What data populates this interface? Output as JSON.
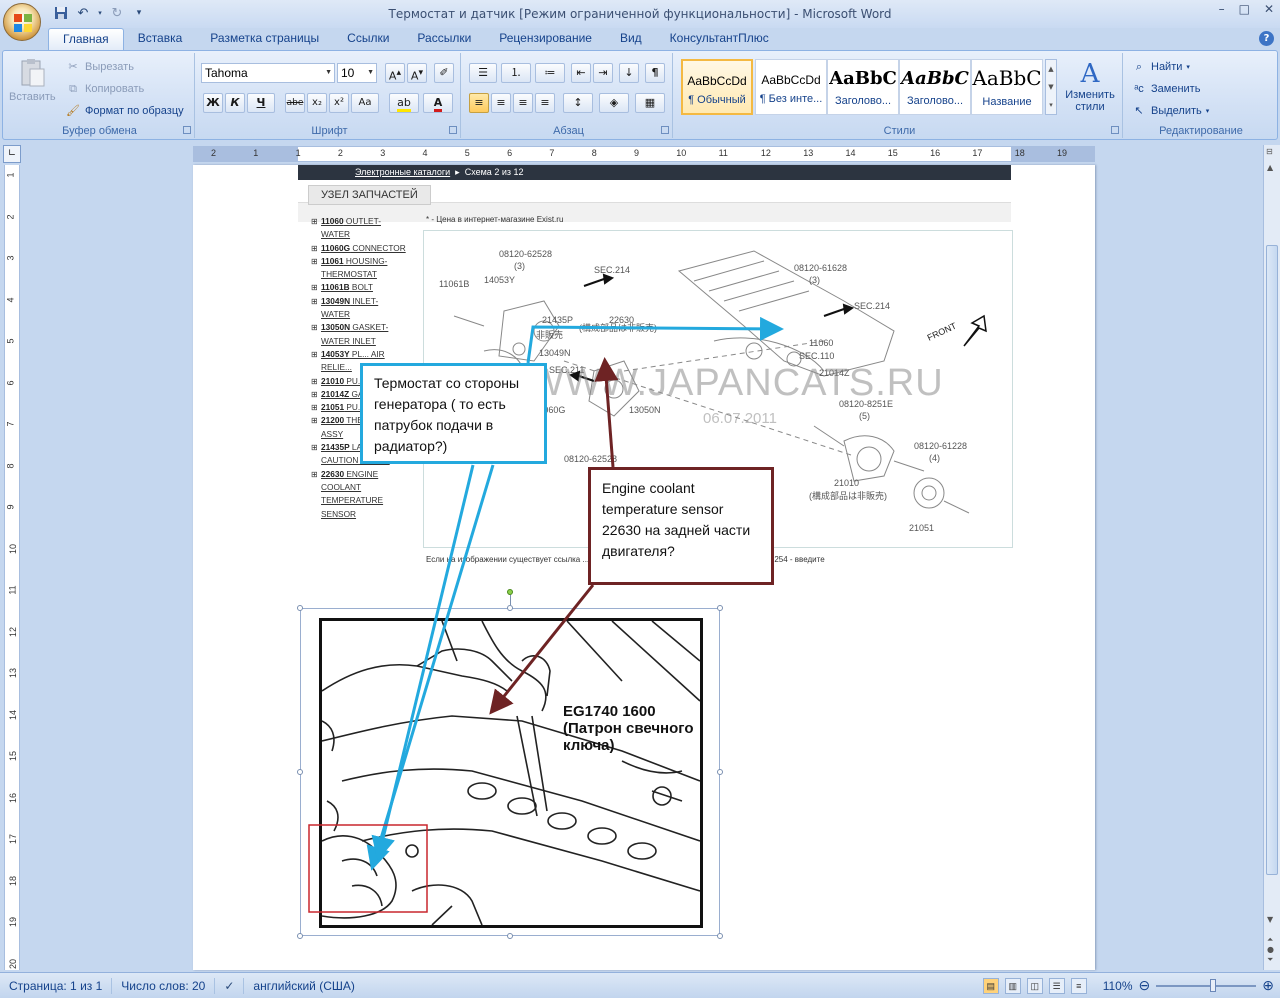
{
  "window": {
    "title": "Термостат и датчик [Режим ограниченной функциональности] - Microsoft Word",
    "controls": [
      "–",
      "□",
      "✕"
    ]
  },
  "tabs": [
    "Главная",
    "Вставка",
    "Разметка страницы",
    "Ссылки",
    "Рассылки",
    "Рецензирование",
    "Вид",
    "КонсультантПлюс"
  ],
  "clipboard": {
    "paste": "Вставить",
    "cut": "Вырезать",
    "copy": "Копировать",
    "format_painter": "Формат по образцу",
    "label": "Буфер обмена"
  },
  "font": {
    "name": "Tahoma",
    "size": "10",
    "label": "Шрифт",
    "buttons": [
      "Ж",
      "К",
      "Ч",
      "abe",
      "x₂",
      "x²",
      "Aa"
    ]
  },
  "paragraph": {
    "label": "Абзац"
  },
  "styles": {
    "label": "Стили",
    "items": [
      {
        "preview": "AaBbCcDd",
        "name": "¶ Обычный"
      },
      {
        "preview": "AaBbCcDd",
        "name": "¶ Без инте..."
      },
      {
        "preview": "AaBbC",
        "name": "Заголово..."
      },
      {
        "preview": "AaBbC",
        "name": "Заголово..."
      },
      {
        "preview": "AaBbC",
        "name": "Название"
      }
    ],
    "change": "Изменить стили"
  },
  "editing": {
    "label": "Редактирование",
    "find": "Найти",
    "replace": "Заменить",
    "select": "Выделить"
  },
  "ruler": {
    "h_numbers": [
      "2",
      "1",
      "1",
      "2",
      "3",
      "4",
      "5",
      "6",
      "7",
      "8",
      "9",
      "10",
      "11",
      "12",
      "13",
      "14",
      "15",
      "16",
      "17",
      "18",
      "19"
    ],
    "v_numbers": [
      "1",
      "2",
      "3",
      "4",
      "5",
      "6",
      "7",
      "8",
      "9",
      "10",
      "11",
      "12",
      "13",
      "14",
      "15",
      "16",
      "17",
      "18",
      "19",
      "20"
    ]
  },
  "document": {
    "catalog_header": "Электронные каталоги  ▸  Схема 2 из 12",
    "catalog_link": "Электронные каталоги",
    "catalog_scheme": "Схема 2 из 12",
    "section_tab": "УЗЕЛ ЗАПЧАСТЕЙ",
    "price_note": "* - Цена в интернет-магазине Exist.ru",
    "parts": [
      {
        "code": "11060",
        "text": "OUTLET-WATER"
      },
      {
        "code": "11060G",
        "text": "CONNECTOR"
      },
      {
        "code": "11061",
        "text": "HOUSING-THERMOSTAT"
      },
      {
        "code": "11061B",
        "text": "BOLT"
      },
      {
        "code": "13049N",
        "text": "INLET-WATER"
      },
      {
        "code": "13050N",
        "text": "GASKET-WATER INLET"
      },
      {
        "code": "14053Y",
        "text": "PL... AIR RELIE..."
      },
      {
        "code": "21010",
        "text": "PU... WATER"
      },
      {
        "code": "21014Z",
        "text": "GA... LIQUID"
      },
      {
        "code": "21051",
        "text": "PU... & WATER"
      },
      {
        "code": "21200",
        "text": "THERMOSTAT ASSY"
      },
      {
        "code": "21435P",
        "text": "LABEL-CAUTION WATER"
      },
      {
        "code": "22630",
        "text": "ENGINE COOLANT TEMPERATURE SENSOR"
      }
    ],
    "bottom_note": "Если на изображении существует ссылка ... от узел введите его номер (например: SEE SEC. 254 - введите",
    "watermark": "WWW.JAPANCATS.RU",
    "watermark_date": "06.07.2011",
    "diagram_labels": [
      "08120-62528",
      "(3)",
      "SEC.214",
      "14053Y",
      "11061B",
      "21435P",
      "非販売",
      "22630",
      "(構成部品は非販売)",
      "13049N",
      "SEC.211",
      "11060G",
      "13050N",
      "08120-62528",
      "08120-61628",
      "(3)",
      "SEC.214",
      "11060",
      "SEC.110",
      "21014Z",
      "08120-8251E",
      "(5)",
      "08120-61228",
      "(4)",
      "21010",
      "(構成部品は非販売)",
      "21051",
      "FRONT"
    ],
    "photo_label": "EG1740 1600\n(Патрон свечного\nключа)",
    "callout_thermostat": "Термостат со стороны генератора ( то есть патрубок подачи в радиатор?)",
    "callout_sensor": "Engine  coolant temperature sensor 22630   на задней части двигателя?"
  },
  "status": {
    "page": "Страница: 1 из 1",
    "words": "Число слов: 20",
    "language": "английский (США)",
    "zoom": "110%"
  },
  "colors": {
    "callout_blue": "#23a9de",
    "callout_brown": "#6e2324",
    "selection_red": "#c8272d"
  }
}
